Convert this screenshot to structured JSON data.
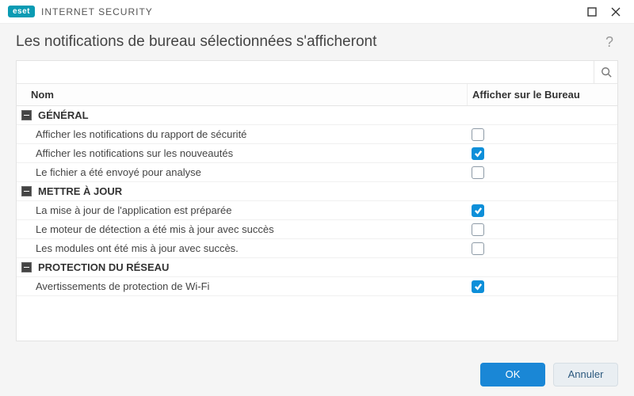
{
  "brand": {
    "badge": "eset",
    "product": "INTERNET SECURITY"
  },
  "header": {
    "title": "Les notifications de bureau sélectionnées s'afficheront"
  },
  "search": {
    "value": "",
    "placeholder": ""
  },
  "columns": {
    "name": "Nom",
    "show": "Afficher sur le Bureau"
  },
  "groups": [
    {
      "label": "GÉNÉRAL",
      "items": [
        {
          "label": "Afficher les notifications du rapport de sécurité",
          "checked": false
        },
        {
          "label": "Afficher les notifications sur les nouveautés",
          "checked": true
        },
        {
          "label": "Le fichier a été envoyé pour analyse",
          "checked": false
        }
      ]
    },
    {
      "label": "METTRE À JOUR",
      "items": [
        {
          "label": "La mise à jour de l'application est préparée",
          "checked": true
        },
        {
          "label": "Le moteur de détection a été mis à jour avec succès",
          "checked": false
        },
        {
          "label": "Les modules ont été mis à jour avec succès.",
          "checked": false
        }
      ]
    },
    {
      "label": "PROTECTION DU RÉSEAU",
      "items": [
        {
          "label": "Avertissements de protection de Wi-Fi",
          "checked": true
        }
      ]
    }
  ],
  "buttons": {
    "ok": "OK",
    "cancel": "Annuler"
  }
}
